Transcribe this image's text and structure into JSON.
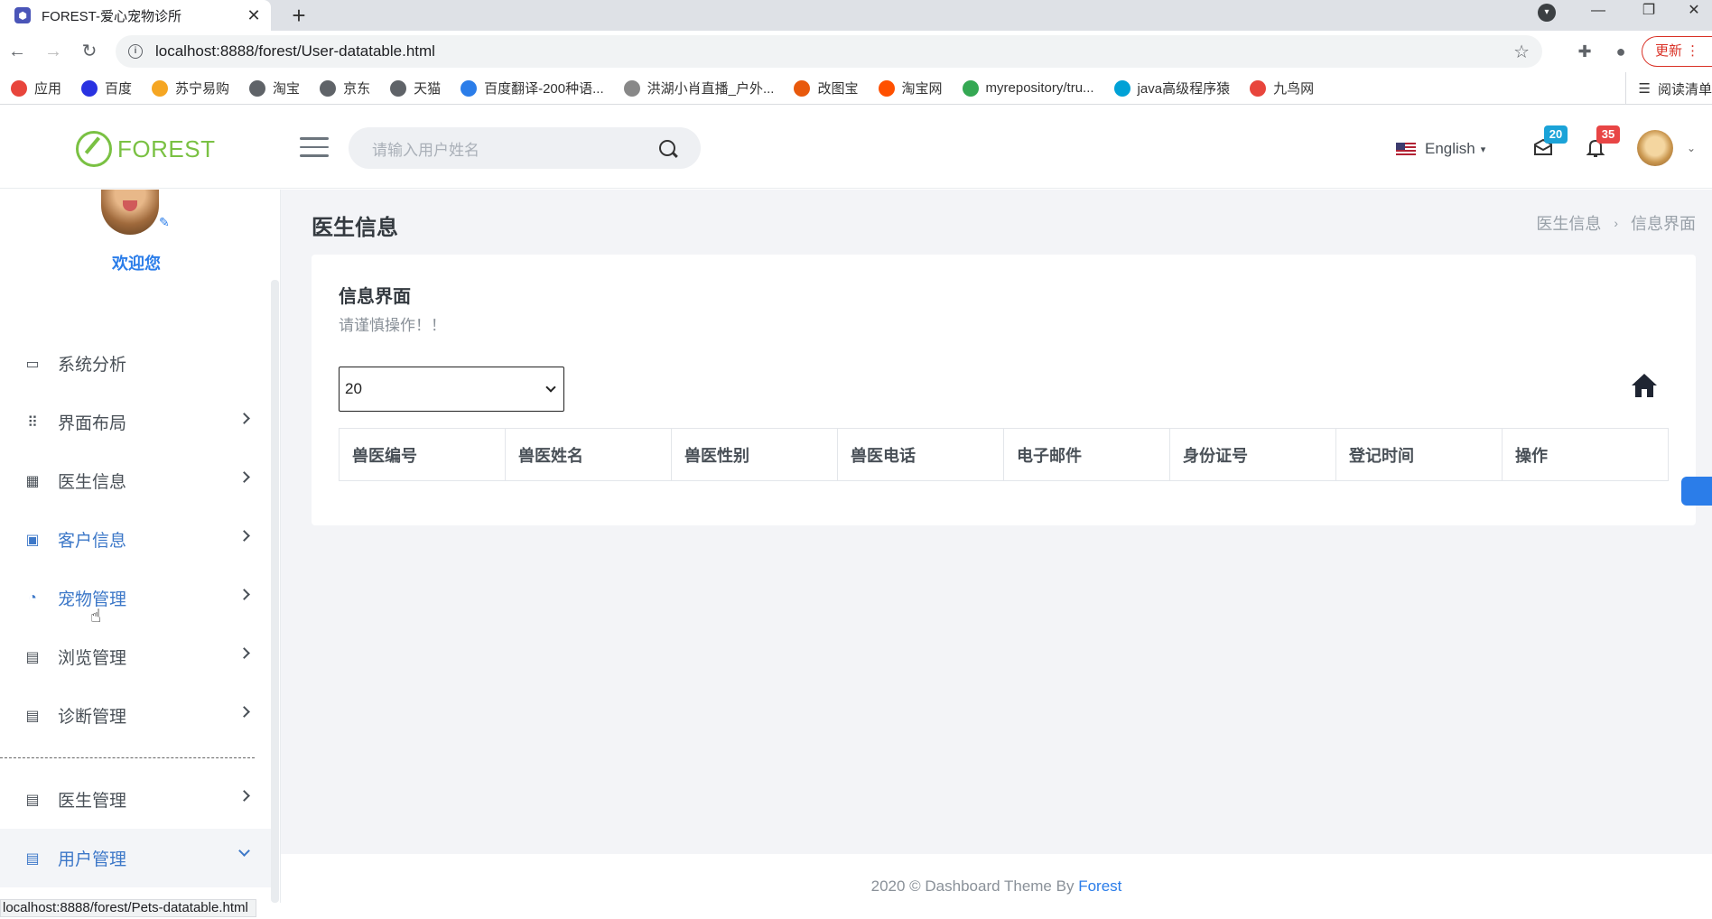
{
  "browser": {
    "tab_title": "FOREST-爱心宠物诊所",
    "tab_close": "✕",
    "new_tab": "+",
    "url": "localhost:8888/forest/User-datatable.html",
    "update_label": "更新",
    "status_url": "localhost:8888/forest/Pets-datatable.html",
    "bookmarks": [
      {
        "label": "应用",
        "color": "#e8453c"
      },
      {
        "label": "百度",
        "color": "#2932e1"
      },
      {
        "label": "苏宁易购",
        "color": "#f5a623"
      },
      {
        "label": "淘宝",
        "color": "#5f6368"
      },
      {
        "label": "京东",
        "color": "#5f6368"
      },
      {
        "label": "天猫",
        "color": "#5f6368"
      },
      {
        "label": "百度翻译-200种语...",
        "color": "#2b7de9"
      },
      {
        "label": "洪湖小肖直播_户外...",
        "color": "#888888"
      },
      {
        "label": "改图宝",
        "color": "#e8590c"
      },
      {
        "label": "淘宝网",
        "color": "#ff5000"
      },
      {
        "label": "myrepository/tru...",
        "color": "#34a853"
      },
      {
        "label": "java高级程序猿",
        "color": "#00a1d6"
      },
      {
        "label": "九鸟网",
        "color": "#e8453c"
      }
    ],
    "reading_list": "阅读清单"
  },
  "header": {
    "logo_text": "FOREST",
    "search_placeholder": "请输入用户姓名",
    "language": "English",
    "messages_count": "20",
    "notifications_count": "35"
  },
  "sidebar": {
    "welcome": "欢迎您",
    "items": [
      {
        "label": "系统分析",
        "icon": "monitor-icon",
        "glyph": "▭",
        "has_chevron": false
      },
      {
        "label": "界面布局",
        "icon": "grid-icon",
        "glyph": "⠿",
        "has_chevron": true
      },
      {
        "label": "医生信息",
        "icon": "calendar-icon",
        "glyph": "▦",
        "has_chevron": true
      },
      {
        "label": "客户信息",
        "icon": "briefcase-icon",
        "glyph": "▣",
        "has_chevron": true
      },
      {
        "label": "宠物管理",
        "icon": "pie-chart-icon",
        "glyph": "◔",
        "has_chevron": true
      },
      {
        "label": "浏览管理",
        "icon": "document-icon",
        "glyph": "▤",
        "has_chevron": true
      },
      {
        "label": "诊断管理",
        "icon": "document-icon",
        "glyph": "▤",
        "has_chevron": true
      }
    ],
    "items_after_divider": [
      {
        "label": "医生管理",
        "icon": "document-icon",
        "glyph": "▤",
        "has_chevron": true
      },
      {
        "label": "用户管理",
        "icon": "document-icon",
        "glyph": "▤",
        "has_chevron": true
      }
    ]
  },
  "main": {
    "page_title": "医生信息",
    "breadcrumb": [
      "医生信息",
      "信息界面"
    ],
    "card_title": "信息界面",
    "card_subtitle": "请谨慎操作！！",
    "page_size": "20",
    "columns": [
      "兽医编号",
      "兽医姓名",
      "兽医性别",
      "兽医电话",
      "电子邮件",
      "身份证号",
      "登记时间",
      "操作"
    ]
  },
  "footer": {
    "text": "2020 © Dashboard Theme By ",
    "brand": "Forest"
  },
  "colors": {
    "accent": "#2b7de9",
    "logo_green": "#7ac143",
    "badge_messages": "#1ba3d8",
    "badge_notifications": "#e84545"
  }
}
